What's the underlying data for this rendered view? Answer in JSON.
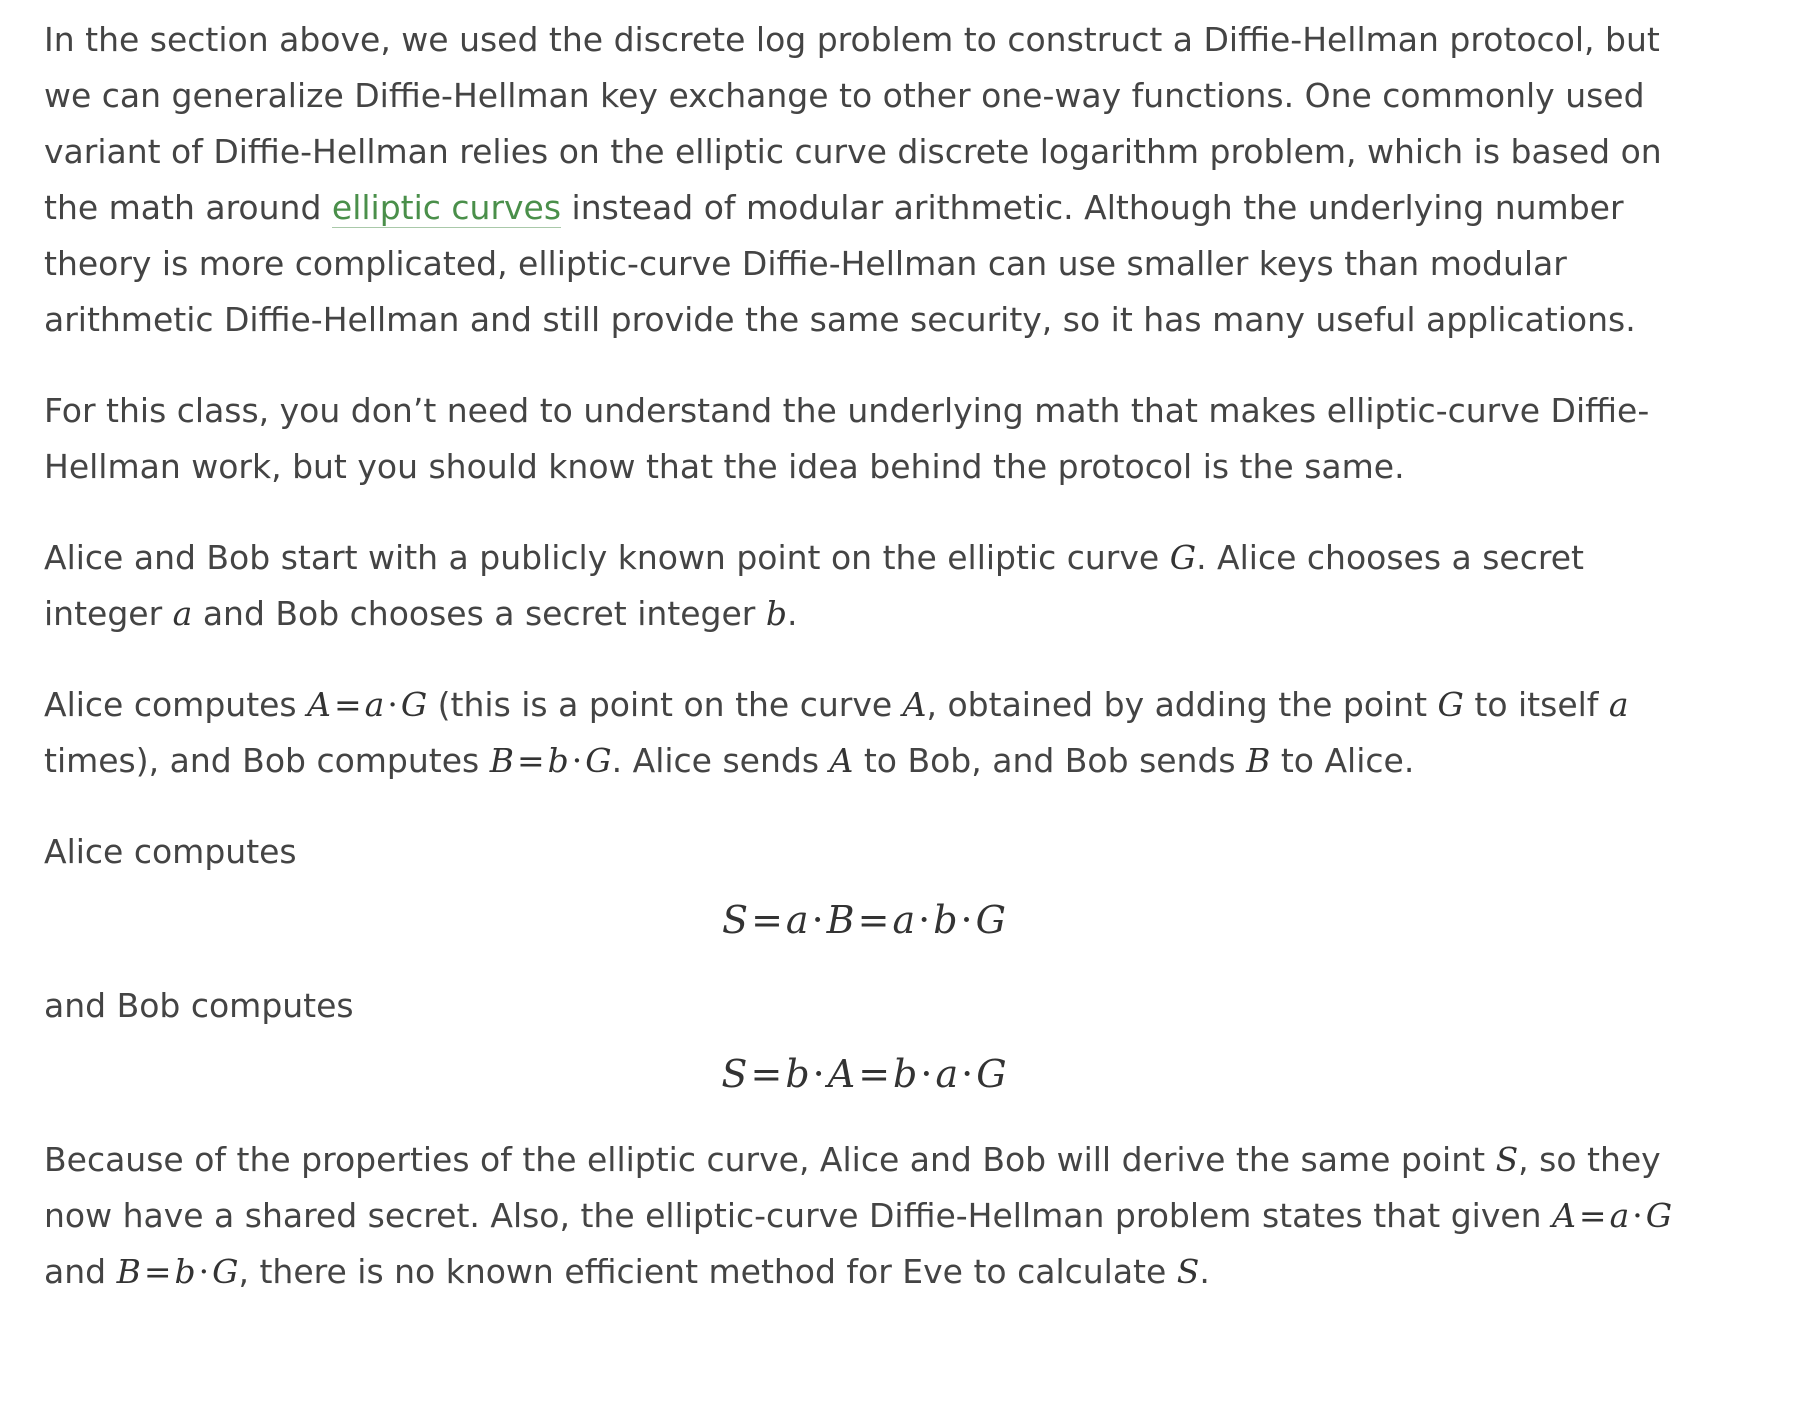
{
  "p1": {
    "before": "In the section above, we used the discrete log problem to construct a Diffie-Hellman protocol, but we can generalize Diffie-Hellman key exchange to other one-way functions. One commonly used variant of Diffie-Hellman relies on the elliptic curve discrete logarithm problem, which is based on the math around ",
    "link": "elliptic curves",
    "after": " instead of modular arithmetic. Although the underlying number theory is more complicated, elliptic-curve Diffie-Hellman can use smaller keys than modular arithmetic Diffie-Hellman and still provide the same security, so it has many useful applications."
  },
  "p2": "For this class, you don’t need to understand the underlying math that makes elliptic-curve Diffie-Hellman work, but you should know that the idea behind the protocol is the same.",
  "p3": {
    "t1": "Alice and Bob start with a publicly known point on the elliptic curve ",
    "t2": ". Alice chooses a secret integer ",
    "t3": " and Bob chooses a secret integer ",
    "t4": "."
  },
  "p4": {
    "t1": "Alice computes ",
    "t2": " (this is a point on the curve ",
    "t3": ", obtained by adding the point ",
    "t4": " to itself ",
    "t5": " times), and Bob computes ",
    "t6": ". Alice sends ",
    "t7": " to Bob, and Bob sends ",
    "t8": " to Alice."
  },
  "p5": "Alice computes",
  "p6": "and Bob computes",
  "p7": {
    "t1": "Because of the properties of the elliptic curve, Alice and Bob will derive the same point ",
    "t2": ", so they now have a shared secret. Also, the elliptic-curve Diffie-Hellman problem states that given ",
    "t3": " and ",
    "t4": ", there is no known efficient method for Eve to calculate ",
    "t5": "."
  },
  "math": {
    "G": "G",
    "a": "a",
    "b": "b",
    "A": "A",
    "B": "B",
    "S": "S",
    "eq": "=",
    "dot": "·"
  }
}
